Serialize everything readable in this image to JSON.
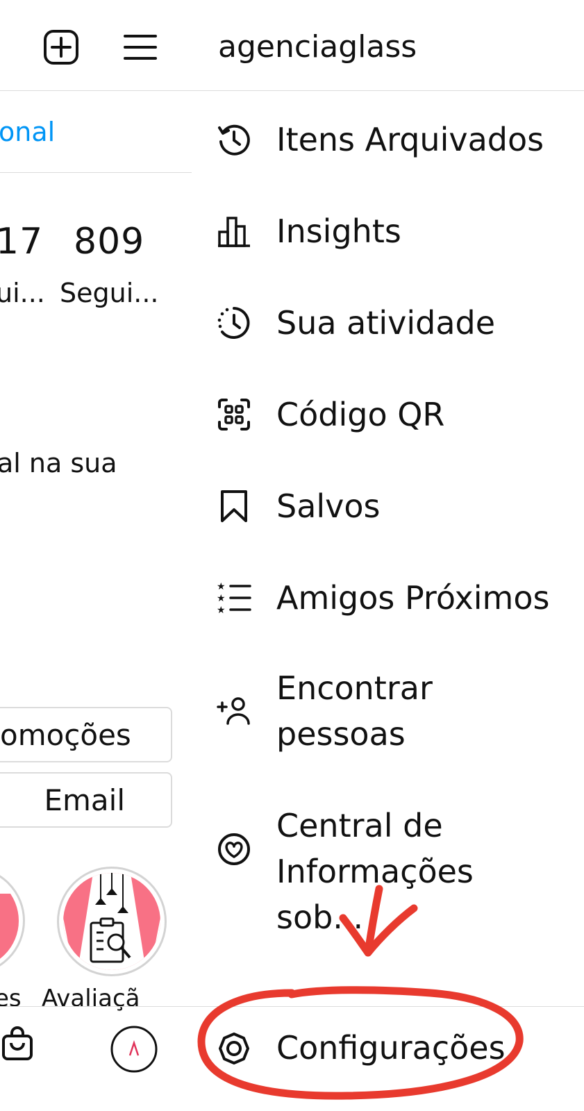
{
  "left_pane": {
    "link_fragment": "onal",
    "stats": [
      {
        "value": "17",
        "label": "ui..."
      },
      {
        "value": "809",
        "label": "Segui..."
      }
    ],
    "bio_fragment": "al na sua",
    "buttons": {
      "promotions": "omoções",
      "email": "Email"
    },
    "highlights": [
      {
        "label": "es"
      },
      {
        "label": "Avaliaçã"
      }
    ],
    "colors": {
      "link": "#0095f6",
      "highlight_pink": "#f87185"
    }
  },
  "drawer": {
    "username": "agenciaglass",
    "items": [
      {
        "label": "Itens Arquivados",
        "icon": "archive-history-icon"
      },
      {
        "label": "Insights",
        "icon": "bar-chart-icon"
      },
      {
        "label": "Sua atividade",
        "icon": "activity-clock-icon"
      },
      {
        "label": "Código QR",
        "icon": "qr-code-icon"
      },
      {
        "label": "Salvos",
        "icon": "bookmark-icon"
      },
      {
        "label": "Amigos Próximos",
        "icon": "close-friends-list-icon"
      },
      {
        "label": "Encontrar pessoas",
        "icon": "add-person-icon"
      },
      {
        "label": "Central de Informações sob...",
        "icon": "covid-info-heart-icon"
      }
    ],
    "settings": {
      "label": "Configurações",
      "icon": "gear-icon"
    }
  },
  "annotation": {
    "color": "#e83a2e"
  }
}
